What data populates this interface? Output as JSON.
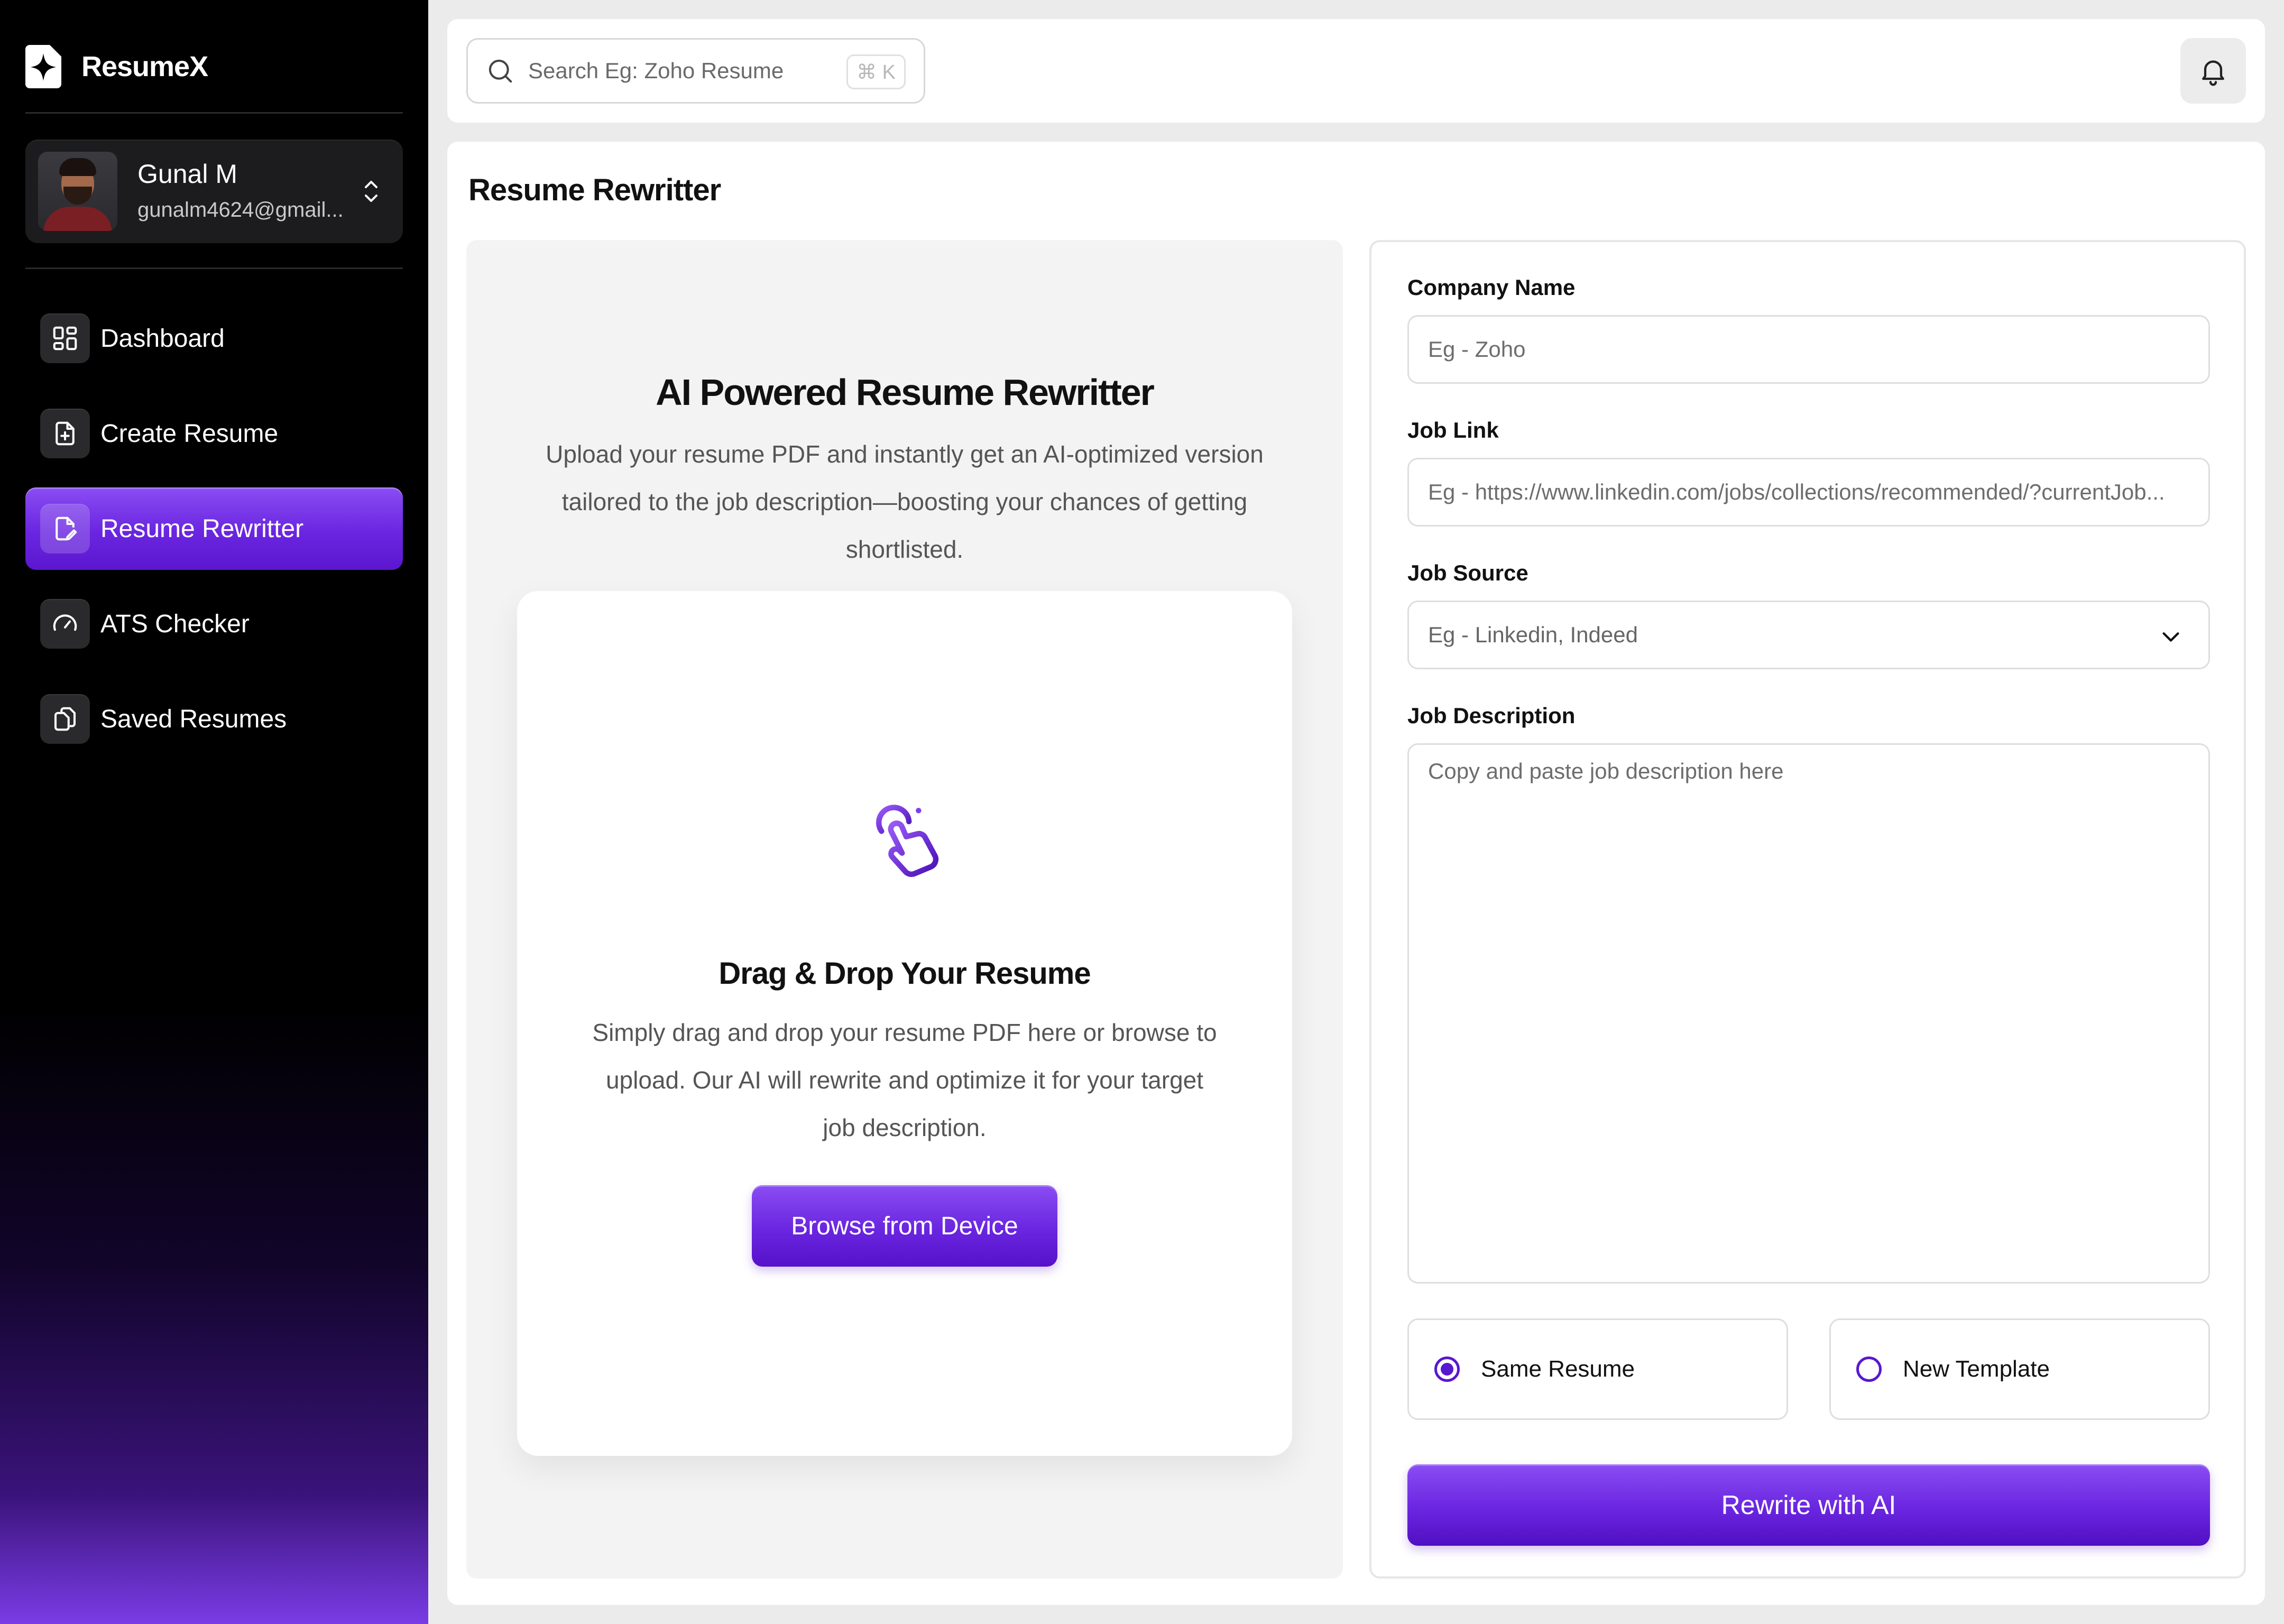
{
  "brand": {
    "name": "ResumeX",
    "icon": "sparkle-logo-icon"
  },
  "user": {
    "name": "Gunal M",
    "email": "gunalm4624@gmail..."
  },
  "nav": [
    {
      "label": "Dashboard",
      "icon": "grid-icon",
      "active": false
    },
    {
      "label": "Create Resume",
      "icon": "file-plus-icon",
      "active": false
    },
    {
      "label": "Resume Rewritter",
      "icon": "file-edit-icon",
      "active": true
    },
    {
      "label": "ATS Checker",
      "icon": "gauge-icon",
      "active": false
    },
    {
      "label": "Saved Resumes",
      "icon": "copy-icon",
      "active": false
    }
  ],
  "search": {
    "placeholder": "Search Eg: Zoho Resume",
    "shortcut": "⌘ K"
  },
  "page": {
    "title": "Resume Rewritter"
  },
  "hero": {
    "title": "AI Powered Resume Rewritter",
    "subtitle": "Upload your resume PDF and instantly get an AI-optimized version tailored to the job description—boosting your chances of getting shortlisted."
  },
  "dropzone": {
    "title": "Drag & Drop Your Resume",
    "subtitle": "Simply drag and drop your resume PDF here or browse to upload. Our AI will rewrite and optimize it for your target job description.",
    "button": "Browse from Device"
  },
  "form": {
    "company": {
      "label": "Company Name",
      "placeholder": "Eg - Zoho"
    },
    "job_link": {
      "label": "Job Link",
      "placeholder": "Eg - https://www.linkedin.com/jobs/collections/recommended/?currentJob..."
    },
    "job_source": {
      "label": "Job Source",
      "placeholder": "Eg - Linkedin, Indeed"
    },
    "job_description": {
      "label": "Job Description",
      "placeholder": "Copy and paste job description here"
    },
    "options": [
      {
        "label": "Same Resume",
        "selected": true
      },
      {
        "label": "New Template",
        "selected": false
      }
    ],
    "submit": "Rewrite with AI"
  },
  "colors": {
    "accent": "#6a25e0",
    "accent_light": "#8a4df3",
    "sidebar": "#000000"
  }
}
